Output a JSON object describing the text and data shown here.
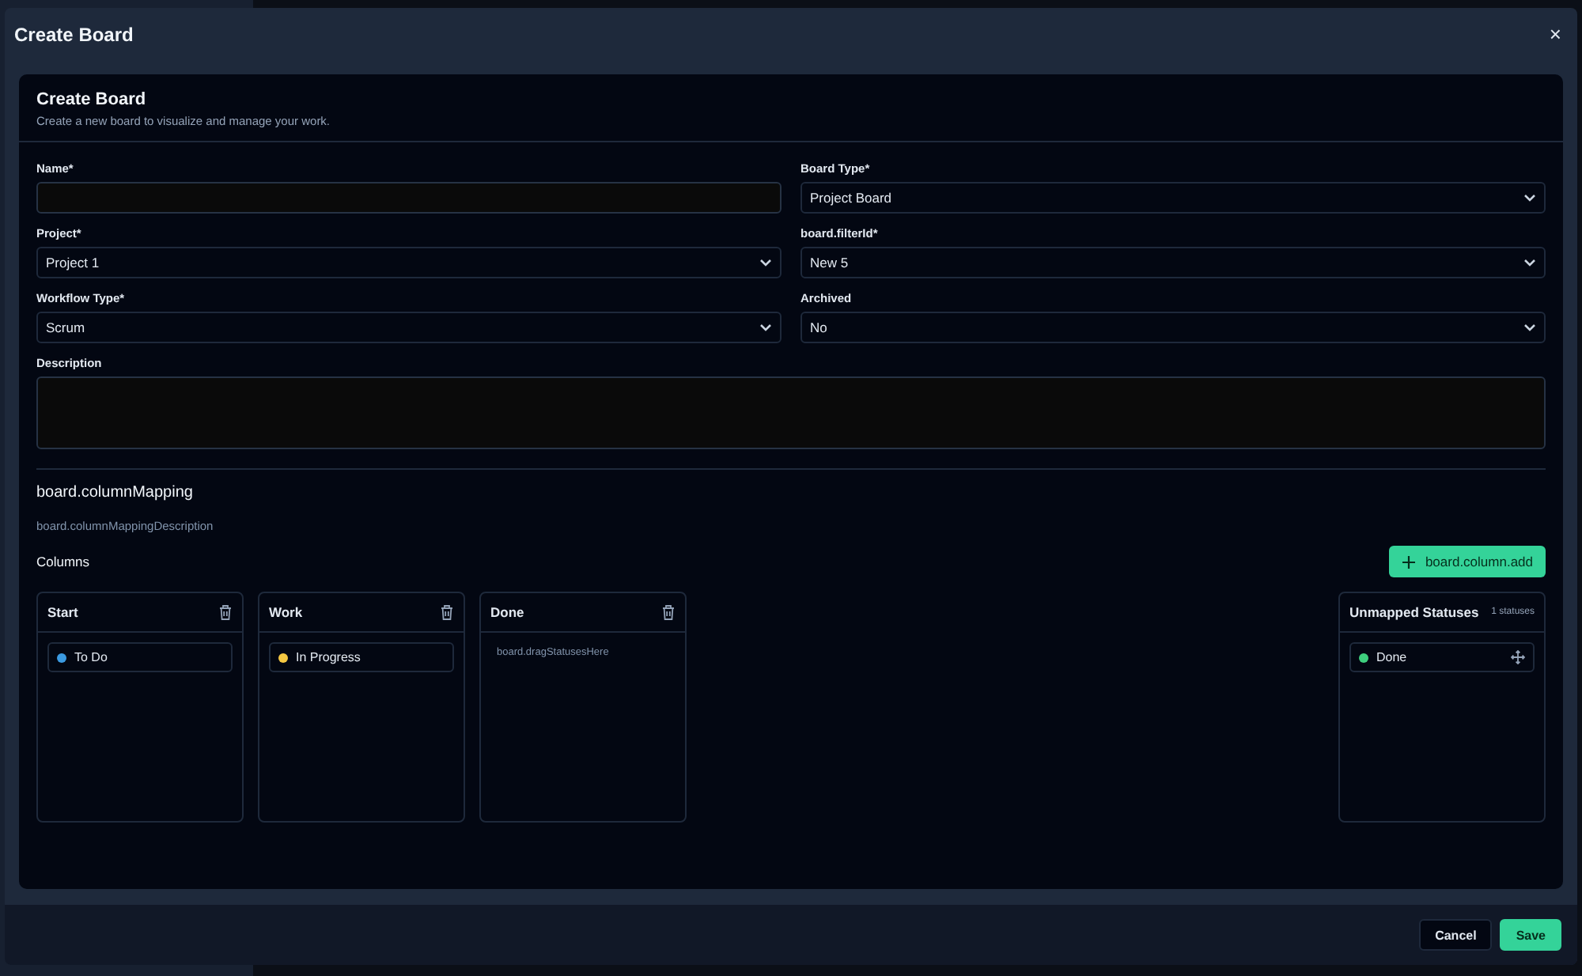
{
  "dialog": {
    "title": "Create Board",
    "close": "×"
  },
  "card": {
    "title": "Create Board",
    "subtitle": "Create a new board to visualize and manage your work."
  },
  "fields": [
    {
      "label": "Name*",
      "kind": "text"
    },
    {
      "label": "Board Type*",
      "kind": "select",
      "value": "Project Board"
    },
    {
      "label": "Project*",
      "kind": "select",
      "value": "Project 1"
    },
    {
      "label": "board.filterId*",
      "kind": "select",
      "value": "New 5"
    },
    {
      "label": "Workflow Type*",
      "kind": "select",
      "value": "Scrum"
    },
    {
      "label": "Archived",
      "kind": "select",
      "value": "No"
    },
    {
      "label": "Description",
      "kind": "textarea"
    }
  ],
  "mapping": {
    "title": "board.columnMapping",
    "description": "board.columnMappingDescription",
    "columns_label": "Columns",
    "add_button": "board.column.add",
    "columns": [
      {
        "name": "Start",
        "statuses": [
          {
            "name": "To Do",
            "color": "#3b9ae1"
          }
        ]
      },
      {
        "name": "Work",
        "statuses": [
          {
            "name": "In Progress",
            "color": "#f5c842"
          }
        ]
      },
      {
        "name": "Done",
        "placeholder": "board.dragStatusesHere"
      }
    ],
    "unmapped": {
      "title": "Unmapped Statuses",
      "count": "1 statuses",
      "statuses": [
        {
          "name": "Done",
          "color": "#3ecf7e"
        }
      ]
    }
  },
  "footer": {
    "buttons": [
      {
        "label": "Cancel",
        "kind": "secondary"
      },
      {
        "label": "Save",
        "kind": "primary"
      }
    ]
  }
}
